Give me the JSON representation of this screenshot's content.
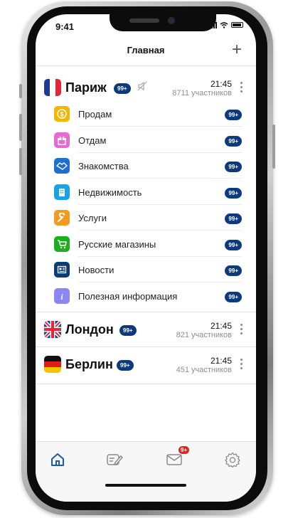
{
  "status": {
    "time": "9:41"
  },
  "header": {
    "title": "Главная",
    "add_label": "+"
  },
  "cities": [
    {
      "name": "Париж",
      "badge": "99+",
      "time": "21:45",
      "members": "8711 участников",
      "muted": true,
      "categories": [
        {
          "label": "Продам",
          "badge": "99+",
          "color": "#f4b400",
          "icon": "coin-icon"
        },
        {
          "label": "Отдам",
          "badge": "99+",
          "color": "#e56ad6",
          "icon": "gift-icon"
        },
        {
          "label": "Знакомства",
          "badge": "99+",
          "color": "#1e6fd0",
          "icon": "handshake-icon"
        },
        {
          "label": "Недвижимость",
          "badge": "99+",
          "color": "#18a3e8",
          "icon": "building-icon"
        },
        {
          "label": "Услуги",
          "badge": "99+",
          "color": "#f59a1c",
          "icon": "wrench-icon"
        },
        {
          "label": "Русские магазины",
          "badge": "99+",
          "color": "#1bb01b",
          "icon": "cart-icon"
        },
        {
          "label": "Новости",
          "badge": "99+",
          "color": "#0d3b78",
          "icon": "newspaper-icon"
        },
        {
          "label": "Полезная информация",
          "badge": "99+",
          "color": "#8a87f2",
          "icon": "info-icon"
        }
      ]
    },
    {
      "name": "Лондон",
      "badge": "99+",
      "time": "21:45",
      "members": "821 участников"
    },
    {
      "name": "Берлин",
      "badge": "99+",
      "time": "21:45",
      "members": "451 участников"
    }
  ],
  "tabbar": {
    "items": [
      "home-icon",
      "edit-icon",
      "mail-icon",
      "settings-icon"
    ],
    "mail_badge": "9+",
    "active_color": "#1d5aa8"
  }
}
